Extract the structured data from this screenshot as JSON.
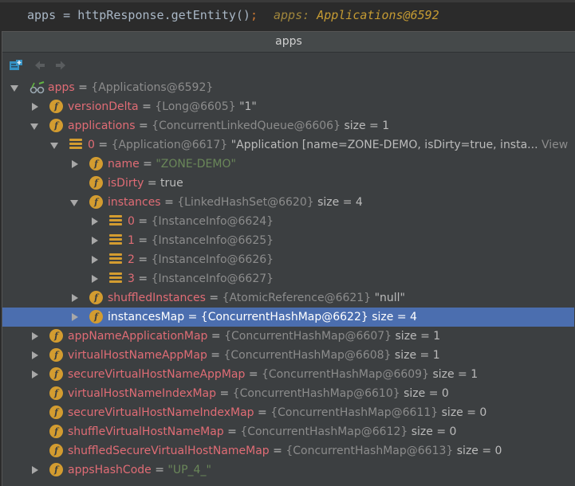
{
  "code_line": {
    "code": "apps = httpResponse.getEntity()",
    "semicolon": ";",
    "hint_name": "apps:",
    "hint_value": "Applications@6592"
  },
  "popup": {
    "title": "apps"
  },
  "toolbar": {
    "icons": [
      "new-watch-icon",
      "back-arrow-icon",
      "forward-arrow-icon"
    ]
  },
  "tree": [
    {
      "name": "apps",
      "eq": "=",
      "type": "{Applications@6592}",
      "value": "",
      "expand": "down",
      "icon": "glasses"
    },
    {
      "name": "versionDelta",
      "eq": "=",
      "type": "{Long@6605}",
      "value": "\"1\"",
      "expand": "right",
      "icon": "field"
    },
    {
      "name": "applications",
      "eq": "=",
      "type": "{ConcurrentLinkedQueue@6606}",
      "value": "size = 1",
      "expand": "down",
      "icon": "field"
    },
    {
      "name": "0",
      "eq": "=",
      "type": "{Application@6617}",
      "value": "\"Application [name=ZONE-DEMO, isDirty=true, insta...",
      "extra": "View",
      "expand": "down",
      "icon": "list"
    },
    {
      "name": "name",
      "eq": "=",
      "type": "",
      "value": "\"ZONE-DEMO\"",
      "expand": "right",
      "icon": "field",
      "string": true
    },
    {
      "name": "isDirty",
      "eq": "=",
      "type": "",
      "value": "true",
      "expand": "",
      "icon": "field"
    },
    {
      "name": "instances",
      "eq": "=",
      "type": "{LinkedHashSet@6620}",
      "value": "size = 4",
      "expand": "down",
      "icon": "field"
    },
    {
      "name": "0",
      "eq": "=",
      "type": "{InstanceInfo@6624}",
      "value": "",
      "expand": "right",
      "icon": "list"
    },
    {
      "name": "1",
      "eq": "=",
      "type": "{InstanceInfo@6625}",
      "value": "",
      "expand": "right",
      "icon": "list"
    },
    {
      "name": "2",
      "eq": "=",
      "type": "{InstanceInfo@6626}",
      "value": "",
      "expand": "right",
      "icon": "list"
    },
    {
      "name": "3",
      "eq": "=",
      "type": "{InstanceInfo@6627}",
      "value": "",
      "expand": "right",
      "icon": "list"
    },
    {
      "name": "shuffledInstances",
      "eq": "=",
      "type": "{AtomicReference@6621}",
      "value": "\"null\"",
      "expand": "right",
      "icon": "field"
    },
    {
      "name": "instancesMap",
      "eq": "=",
      "type": "{ConcurrentHashMap@6622}",
      "value": "size = 4",
      "expand": "right",
      "icon": "field",
      "selected": true
    },
    {
      "name": "appNameApplicationMap",
      "eq": "=",
      "type": "{ConcurrentHashMap@6607}",
      "value": "size = 1",
      "expand": "right",
      "icon": "field"
    },
    {
      "name": "virtualHostNameAppMap",
      "eq": "=",
      "type": "{ConcurrentHashMap@6608}",
      "value": "size = 1",
      "expand": "right",
      "icon": "field"
    },
    {
      "name": "secureVirtualHostNameAppMap",
      "eq": "=",
      "type": "{ConcurrentHashMap@6609}",
      "value": "size = 1",
      "expand": "right",
      "icon": "field"
    },
    {
      "name": "virtualHostNameIndexMap",
      "eq": "=",
      "type": "{ConcurrentHashMap@6610}",
      "value": "size = 0",
      "expand": "",
      "icon": "field"
    },
    {
      "name": "secureVirtualHostNameIndexMap",
      "eq": "=",
      "type": "{ConcurrentHashMap@6611}",
      "value": "size = 0",
      "expand": "",
      "icon": "field"
    },
    {
      "name": "shuffleVirtualHostNameMap",
      "eq": "=",
      "type": "{ConcurrentHashMap@6612}",
      "value": "size = 0",
      "expand": "",
      "icon": "field"
    },
    {
      "name": "shuffledSecureVirtualHostNameMap",
      "eq": "=",
      "type": "{ConcurrentHashMap@6613}",
      "value": "size = 0",
      "expand": "",
      "icon": "field"
    },
    {
      "name": "appsHashCode",
      "eq": "=",
      "type": "",
      "value": "\"UP_4_\"",
      "expand": "right",
      "icon": "field",
      "string": true
    }
  ],
  "colors": {
    "name": "#e06c75",
    "type": "#8c8c8c",
    "string": "#6a8759",
    "selection": "#4b6eaf",
    "field_icon": "#d39c30"
  }
}
